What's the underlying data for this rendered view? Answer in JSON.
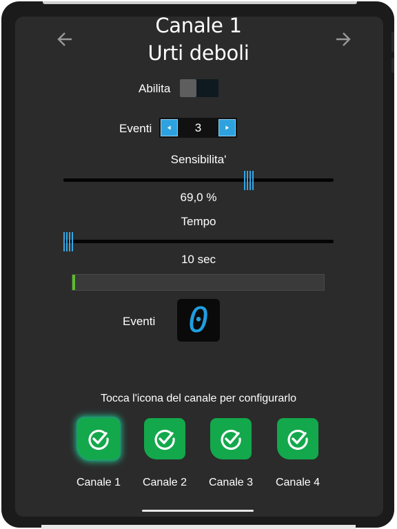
{
  "header": {
    "title_line1": "Canale 1",
    "title_line2": "Urti deboli",
    "back_icon": "arrow-left-icon",
    "forward_icon": "arrow-right-icon"
  },
  "enable": {
    "label": "Abilita",
    "on": false
  },
  "events_stepper": {
    "label": "Eventi",
    "value": "3"
  },
  "sensitivity": {
    "label": "Sensibilita'",
    "value_text": "69,0 %",
    "level": 0.69
  },
  "time": {
    "label": "Tempo",
    "value_text": "10 sec",
    "level": 0.02
  },
  "progress": {
    "level": 0.01
  },
  "events_counter": {
    "label": "Eventi",
    "digit": "0"
  },
  "channels": {
    "hint": "Tocca l'icona del canale per configurarlo",
    "items": [
      {
        "label": "Canale 1",
        "selected": true
      },
      {
        "label": "Canale 2",
        "selected": false
      },
      {
        "label": "Canale 3",
        "selected": false
      },
      {
        "label": "Canale 4",
        "selected": false
      }
    ]
  },
  "colors": {
    "accent": "#2ea2df",
    "icon_green": "#13a84b",
    "progress_green": "#5dbb2b"
  }
}
